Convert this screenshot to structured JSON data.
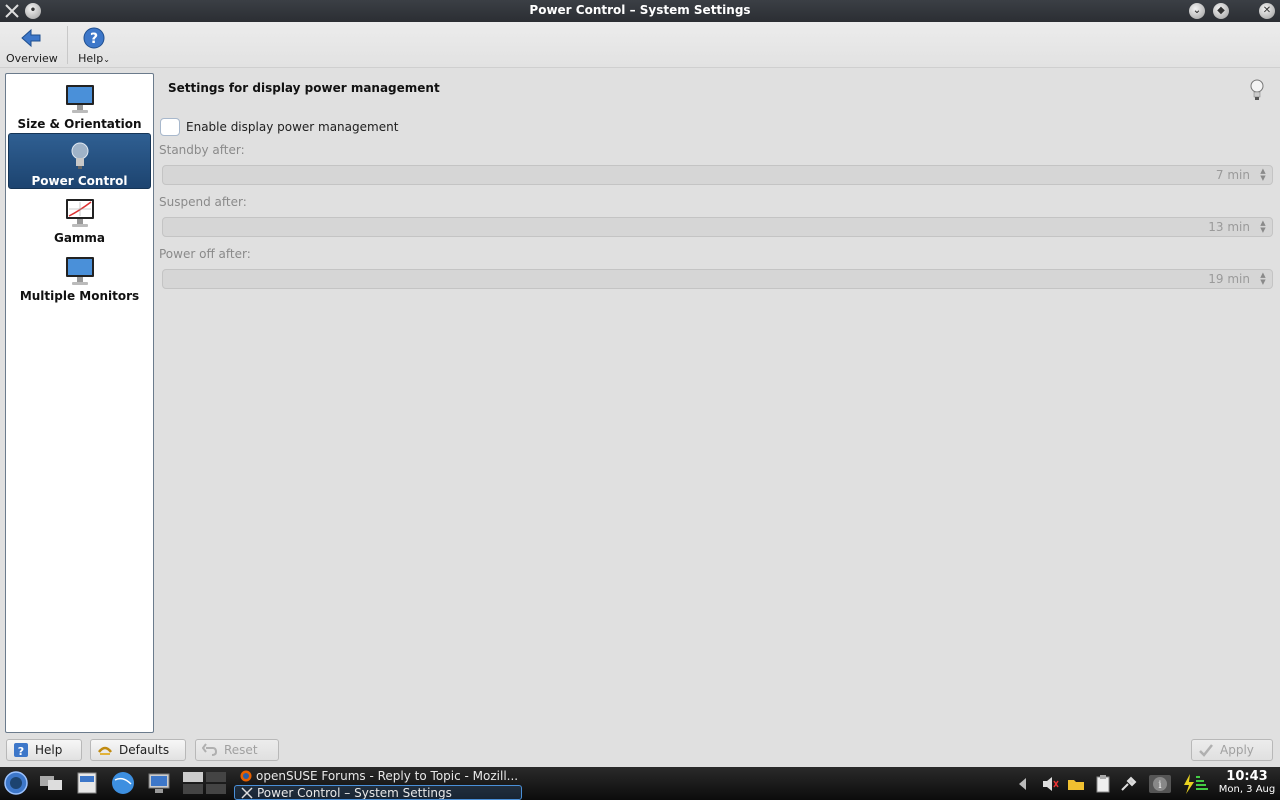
{
  "window": {
    "title": "Power Control – System Settings"
  },
  "toolbar": {
    "overview_label": "Overview",
    "help_label": "Help"
  },
  "sidebar": {
    "items": [
      {
        "label": "Size & Orientation",
        "icon": "monitor-icon"
      },
      {
        "label": "Power Control",
        "icon": "lightbulb-icon"
      },
      {
        "label": "Gamma",
        "icon": "gamma-monitor-icon"
      },
      {
        "label": "Multiple Monitors",
        "icon": "monitor-icon"
      }
    ],
    "selected": "Power Control"
  },
  "main": {
    "heading": "Settings for display power management",
    "enable_label": "Enable display power management",
    "enable_checked": false,
    "standby": {
      "label": "Standby after:",
      "value": "7 min"
    },
    "suspend": {
      "label": "Suspend after:",
      "value": "13 min"
    },
    "poweroff": {
      "label": "Power off after:",
      "value": "19 min"
    }
  },
  "buttons": {
    "help": "Help",
    "defaults": "Defaults",
    "reset": "Reset",
    "apply": "Apply"
  },
  "taskbar": {
    "tasks": [
      {
        "label": "openSUSE Forums - Reply to Topic - Mozill..."
      },
      {
        "label": "Power Control – System Settings"
      }
    ],
    "clock_time": "10:43",
    "clock_date": "Mon, 3 Aug"
  },
  "colors": {
    "selection": "#1d4470",
    "titlebar": "#2b2e33",
    "taskbar_focus": "#4a90d9"
  }
}
